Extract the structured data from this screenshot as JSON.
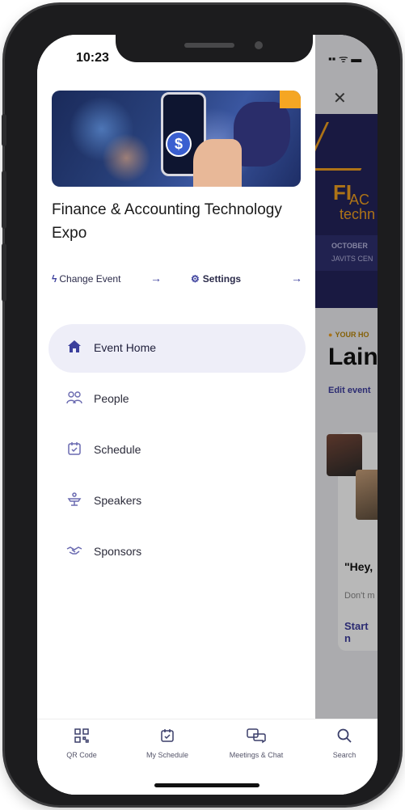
{
  "status": {
    "time": "10:23",
    "icons": "▪▪ ᯤ ▬"
  },
  "event": {
    "title": "Finance & Accounting Technology Expo"
  },
  "actions": {
    "change_event": "Change Event",
    "settings": "Settings"
  },
  "nav": [
    {
      "label": "Event Home",
      "icon": "home-icon",
      "active": true
    },
    {
      "label": "People",
      "icon": "people-icon",
      "active": false
    },
    {
      "label": "Schedule",
      "icon": "calendar-icon",
      "active": false
    },
    {
      "label": "Speakers",
      "icon": "podium-icon",
      "active": false
    },
    {
      "label": "Sponsors",
      "icon": "handshake-icon",
      "active": false
    }
  ],
  "tabs": [
    {
      "label": "QR Code",
      "icon": "qr-code-icon"
    },
    {
      "label": "My Schedule",
      "icon": "calendar-check-icon"
    },
    {
      "label": "Meetings & Chat",
      "icon": "chat-bubbles-icon"
    },
    {
      "label": "Search",
      "icon": "search-icon"
    }
  ],
  "background_page": {
    "banner_fi": "FI",
    "banner_ac": "AC",
    "banner_tech": "techn",
    "banner_date": "OCTOBER",
    "banner_venue": "JAVITS CEN",
    "label": "YOUR HO",
    "name": "Laine",
    "edit": "Edit event",
    "quote": "\"Hey,",
    "dont": "Don't m",
    "start": "Start n"
  },
  "colors": {
    "accent": "#3b3f9c",
    "active_bg": "#eeeef8",
    "orange": "#f5a623"
  }
}
